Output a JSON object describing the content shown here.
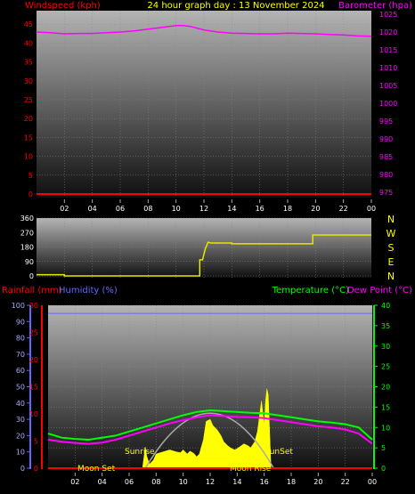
{
  "header": {
    "title": "24 hour graph day : 13 November 2024",
    "windspeed_label": "Windspeed (kph)",
    "barometer_label": "Barometer (hpa)"
  },
  "middle": {
    "compass": [
      "N",
      "W",
      "S",
      "E",
      "N"
    ]
  },
  "lower_header": {
    "rainfall_label": "Rainfall (mm)",
    "humidity_label": "Humidity (%)",
    "temperature_label": "Temperature (°C)",
    "dewpoint_label": "Dew Point (°C)"
  },
  "annotations": {
    "moon_set": "Moon Set",
    "sunrise": "Sunrise",
    "sunset": "SunSet",
    "moon_rise": "Moon Rise"
  },
  "colors": {
    "windspeed": "#ff0000",
    "barometer": "#ff00ff",
    "title": "#ffff00",
    "wind_direction": "#e6e600",
    "rainfall": "#ff0000",
    "humidity": "#ff00ff",
    "temperature": "#00ff00",
    "dewpoint": "#ff00ff",
    "humidity_axis": "#6666ff",
    "solar": "#ffff00",
    "sun_arc": "#aaaaaa"
  },
  "chart_data": [
    {
      "type": "line",
      "x_ticks": [
        "02",
        "04",
        "06",
        "08",
        "10",
        "12",
        "14",
        "16",
        "18",
        "20",
        "22",
        "00"
      ],
      "left_axis": {
        "label": "Windspeed (kph)",
        "ticks": [
          0,
          5,
          10,
          15,
          20,
          25,
          30,
          35,
          40,
          45,
          50
        ],
        "ylim": [
          0,
          50
        ]
      },
      "right_axis": {
        "label": "Barometer (hpa)",
        "ticks": [
          975,
          980,
          985,
          990,
          995,
          1000,
          1005,
          1010,
          1015,
          1020,
          1025
        ],
        "ylim": [
          973.5,
          1027.5
        ]
      },
      "series": [
        {
          "name": "Windspeed (kph)",
          "axis": "left",
          "x": [
            0,
            24
          ],
          "values": [
            0,
            0
          ]
        },
        {
          "name": "Barometer (hpa)",
          "axis": "right",
          "x": [
            0,
            1,
            2,
            3,
            4,
            5,
            6,
            7,
            8,
            9,
            10,
            10.5,
            11,
            12,
            13,
            14,
            15,
            16,
            17,
            18,
            19,
            20,
            21,
            22,
            23,
            24
          ],
          "values": [
            1020.0,
            1019.8,
            1019.5,
            1019.6,
            1019.6,
            1019.8,
            1020.0,
            1020.3,
            1020.8,
            1021.3,
            1021.8,
            1021.8,
            1021.6,
            1020.6,
            1020.0,
            1019.7,
            1019.6,
            1019.5,
            1019.5,
            1019.7,
            1019.6,
            1019.5,
            1019.3,
            1019.2,
            1018.9,
            1018.8
          ]
        }
      ]
    },
    {
      "type": "line",
      "x_ticks": [
        "02",
        "04",
        "06",
        "08",
        "10",
        "12",
        "14",
        "16",
        "18",
        "20",
        "22",
        "00"
      ],
      "left_axis": {
        "ticks": [
          0,
          90,
          180,
          270,
          360
        ],
        "ylim": [
          0,
          360
        ]
      },
      "right_axis": {
        "ticks": [
          "N",
          "W",
          "S",
          "E",
          "N"
        ]
      },
      "series": [
        {
          "name": "Wind Direction",
          "x": [
            0,
            2,
            2,
            11.7,
            11.7,
            11.9,
            12.0,
            12.1,
            12.3,
            12.5,
            14.0,
            14.0,
            19.8,
            19.8,
            24
          ],
          "values": [
            8,
            8,
            0,
            0,
            100,
            100,
            135,
            170,
            210,
            205,
            205,
            200,
            200,
            255,
            255
          ]
        }
      ]
    },
    {
      "type": "line",
      "x_ticks": [
        "02",
        "04",
        "06",
        "08",
        "10",
        "12",
        "14",
        "16",
        "18",
        "20",
        "22",
        "00"
      ],
      "left_axis_1": {
        "label": "Humidity (%)",
        "ticks": [
          0,
          10,
          20,
          30,
          40,
          50,
          60,
          70,
          80,
          90,
          100
        ],
        "ylim": [
          0,
          100
        ]
      },
      "left_axis_2": {
        "label": "Rainfall (mm)",
        "ticks": [
          0,
          5,
          10,
          15,
          20,
          25,
          30
        ],
        "ylim": [
          0,
          30
        ]
      },
      "right_axis": {
        "label": "Temperature (°C)",
        "ticks": [
          0,
          5,
          10,
          15,
          20,
          25,
          30,
          35,
          40
        ],
        "ylim": [
          0,
          40
        ]
      },
      "series": [
        {
          "name": "Temperature (°C)",
          "axis": "right",
          "x": [
            0,
            1,
            2,
            3,
            4,
            5,
            6,
            7,
            8,
            9,
            10,
            11,
            12,
            13,
            14,
            15,
            16,
            17,
            18,
            19,
            20,
            21,
            22,
            23,
            24
          ],
          "values": [
            8.5,
            7.5,
            7.2,
            7.0,
            7.5,
            8.0,
            9.0,
            10.0,
            11.0,
            12.0,
            13.0,
            13.8,
            14.2,
            14.0,
            13.8,
            13.6,
            13.5,
            13.0,
            12.5,
            12.0,
            11.5,
            11.2,
            10.8,
            10.0,
            7.0
          ]
        },
        {
          "name": "Dew Point (°C)",
          "axis": "right",
          "x": [
            0,
            1,
            2,
            3,
            4,
            5,
            6,
            7,
            8,
            9,
            10,
            11,
            12,
            13,
            14,
            15,
            16,
            17,
            18,
            19,
            20,
            21,
            22,
            23,
            24
          ],
          "values": [
            7.0,
            6.5,
            6.2,
            6.0,
            6.3,
            7.0,
            8.0,
            9.0,
            10.0,
            11.0,
            11.8,
            12.5,
            13.0,
            12.8,
            12.6,
            12.5,
            12.3,
            11.8,
            11.3,
            10.8,
            10.3,
            10.0,
            9.5,
            8.5,
            6.0
          ]
        },
        {
          "name": "Humidity (%)",
          "axis": "left_1",
          "x": [
            0,
            24
          ],
          "values": [
            95,
            95
          ]
        },
        {
          "name": "Rainfall (mm)",
          "axis": "left_2",
          "x": [
            0,
            24
          ],
          "values": [
            0,
            0
          ]
        },
        {
          "name": "Solar",
          "type": "area",
          "x": [
            7.0,
            7.2,
            7.3,
            7.5,
            7.8,
            8.0,
            8.5,
            9.0,
            9.5,
            9.8,
            10.0,
            10.3,
            10.5,
            10.8,
            11.0,
            11.2,
            11.5,
            11.7,
            12.0,
            12.2,
            12.5,
            12.8,
            13.0,
            13.3,
            13.5,
            13.8,
            14.0,
            14.3,
            14.5,
            14.8,
            15.0,
            15.3,
            15.5,
            15.7,
            15.8,
            16.0,
            16.1,
            16.2,
            16.3,
            16.5
          ],
          "values": [
            0.3,
            5.2,
            3.0,
            1.0,
            2.0,
            3.5,
            4.0,
            4.5,
            4.0,
            3.8,
            4.5,
            3.5,
            4.2,
            3.6,
            2.8,
            3.5,
            7.0,
            11.5,
            12.0,
            10.5,
            9.5,
            8.0,
            6.5,
            5.5,
            5.0,
            4.5,
            4.8,
            5.5,
            6.0,
            5.5,
            5.0,
            6.5,
            9.0,
            14.0,
            16.5,
            10.5,
            16.5,
            19.5,
            18.0,
            0.3
          ]
        },
        {
          "name": "Sun Arc",
          "type": "curve",
          "x": [
            7.2,
            12.0,
            16.7
          ],
          "values": [
            0,
            13.5,
            0
          ]
        }
      ]
    }
  ]
}
